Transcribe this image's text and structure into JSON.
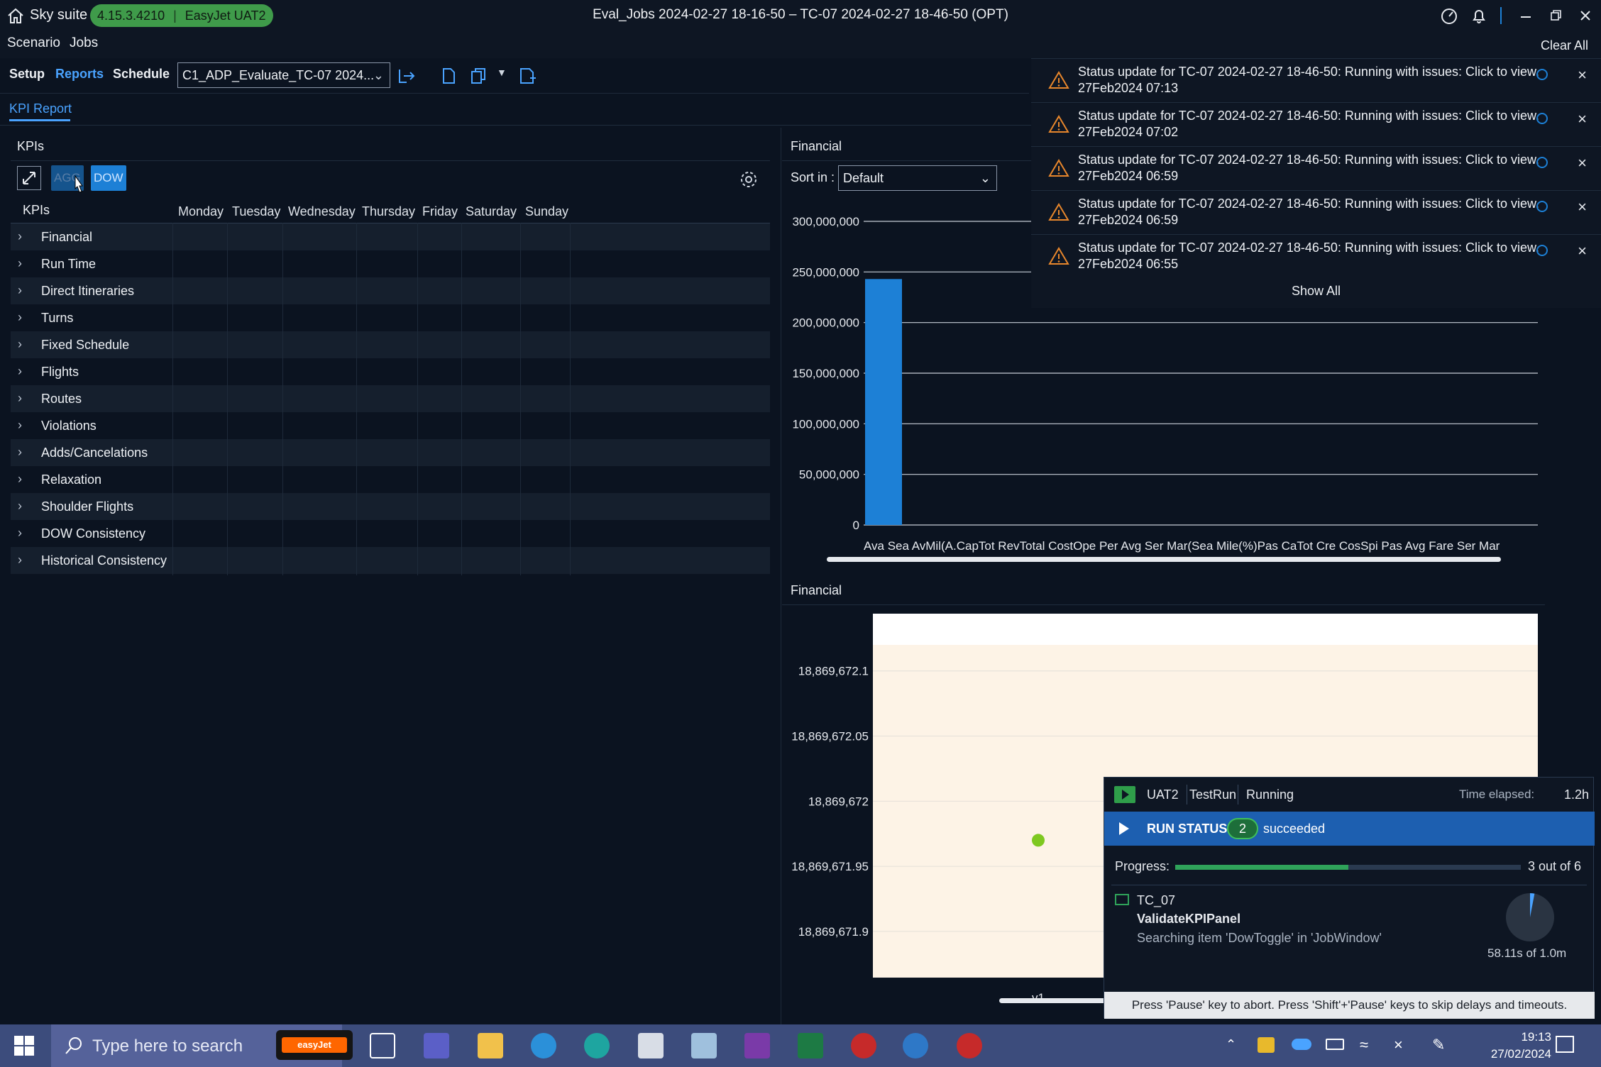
{
  "titlebar": {
    "app_name": "Sky suite",
    "version": "4.15.3.4210",
    "env": "EasyJet UAT2",
    "window_title": "Eval_Jobs 2024-02-27 18-16-50 – TC-07 2024-02-27 18-46-50 (OPT)"
  },
  "menu": {
    "scenario": "Scenario",
    "jobs": "Jobs"
  },
  "toolbar": {
    "tabs": [
      "Setup",
      "Reports",
      "Schedule"
    ],
    "active_tab": "Reports",
    "job_combo": "C1_ADP_Evaluate_TC-07 2024..."
  },
  "report_tab": "KPI Report",
  "kpi_panel": {
    "title": "KPIs",
    "toggle_agg": "AGG",
    "toggle_dow": "DOW",
    "column_header": "KPIs",
    "days": [
      "Monday",
      "Tuesday",
      "Wednesday",
      "Thursday",
      "Friday",
      "Saturday",
      "Sunday"
    ],
    "rows": [
      "Financial",
      "Run Time",
      "Direct Itineraries",
      "Turns",
      "Fixed Schedule",
      "Flights",
      "Routes",
      "Violations",
      "Adds/Cancelations",
      "Relaxation",
      "Shoulder Flights",
      "DOW Consistency",
      "Historical Consistency"
    ]
  },
  "financial_top": {
    "title": "Financial",
    "sort_label": "Sort in :",
    "sort_value": "Default",
    "x_overlap_text": "Ava Sea AvMil(A.CapTot RevTotal CostOpe Per Avg Ser Mar(Sea Mile(%)Pas CaTot Cre CosSpi Pas Avg Fare Ser Mar"
  },
  "financial_bottom": {
    "title": "Financial"
  },
  "chart_data": [
    {
      "type": "bar",
      "title": "Financial",
      "categories": [
        "Ava Sea",
        "Mil (A.Cap)",
        "Tot Rev",
        "Total Cost",
        "Ope Per",
        "Avg Ser Mar (Sea Mile)",
        "(%)",
        "Pas Ca",
        "Tot Cre Cos",
        "Spi Pas",
        "Avg Fare",
        "Ser Mar"
      ],
      "values": [
        243000000,
        null,
        null,
        null,
        null,
        null,
        null,
        null,
        null,
        null,
        null,
        null
      ],
      "ylim": [
        0,
        300000000
      ],
      "yticks": [
        "0",
        "50,000,000",
        "100,000,000",
        "150,000,000",
        "200,000,000",
        "250,000,000",
        "300,000,000"
      ],
      "bar_color": "#1d80d6",
      "grid": true
    },
    {
      "type": "scatter",
      "title": "Financial",
      "x": [
        "v1"
      ],
      "y": [
        18869671.97
      ],
      "ylim": [
        18869671.87,
        18869672.12
      ],
      "yticks": [
        "18,869,671.9",
        "18,869,671.95",
        "18,869,672",
        "18,869,672.05",
        "18,869,672.1"
      ],
      "point_color": "#7ec820",
      "plot_bg": "#fdf3e6"
    }
  ],
  "notifications": {
    "clear_all": "Clear All",
    "show_all": "Show All",
    "items": [
      {
        "text": "Status update for TC-07 2024-02-27 18-46-50: Running with issues: Click to view.",
        "time": "27Feb2024 07:13"
      },
      {
        "text": "Status update for TC-07 2024-02-27 18-46-50: Running with issues: Click to view.",
        "time": "27Feb2024 07:02"
      },
      {
        "text": "Status update for TC-07 2024-02-27 18-46-50: Running with issues: Click to view.",
        "time": "27Feb2024 06:59"
      },
      {
        "text": "Status update for TC-07 2024-02-27 18-46-50: Running with issues: Click to view.",
        "time": "27Feb2024 06:59"
      },
      {
        "text": "Status update for TC-07 2024-02-27 18-46-50: Running with issues: Click to view.",
        "time": "27Feb2024 06:55"
      }
    ]
  },
  "run_popup": {
    "env": "UAT2",
    "kind": "TestRun",
    "state": "Running",
    "elapsed_label": "Time elapsed:",
    "elapsed_value": "1.2h",
    "run_status_label": "RUN STATUS",
    "succeeded_count": "2",
    "succeeded_label": "succeeded",
    "progress_label": "Progress:",
    "progress_fraction": 0.5,
    "progress_text": "3 out of 6",
    "test_id": "TC_07",
    "test_name": "ValidateKPIPanel",
    "test_detail": "Searching item 'DowToggle' in 'JobWindow'",
    "timer_text": "58.11s of 1.0m",
    "timer_fraction": 0.03,
    "footer": "Press 'Pause' key to abort. Press 'Shift'+'Pause' keys to skip delays and timeouts."
  },
  "taskbar": {
    "search_placeholder": "Type here to search",
    "time": "19:13",
    "date": "27/02/2024",
    "easyjet_label": "easyJet"
  }
}
